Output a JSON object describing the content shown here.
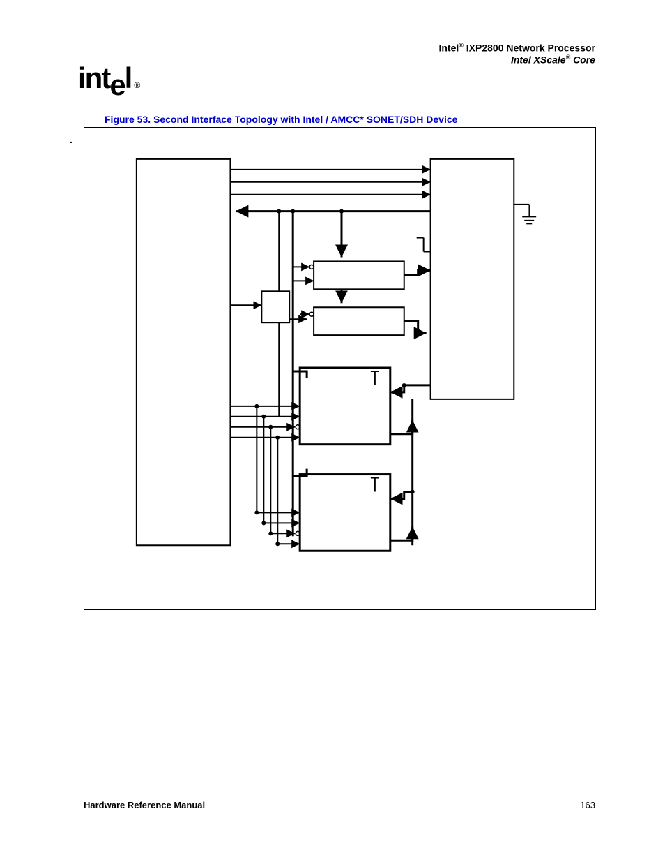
{
  "header": {
    "line1_prefix": "Intel",
    "line1_suffix": " IXP2800 Network Processor",
    "line2_prefix": "Intel XScale",
    "line2_suffix": " Core"
  },
  "logo_text": "intel",
  "figure_caption": "Figure 53. Second Interface Topology with Intel / AMCC* SONET/SDH Device",
  "footer": {
    "left": "Hardware Reference Manual",
    "page": "163"
  }
}
